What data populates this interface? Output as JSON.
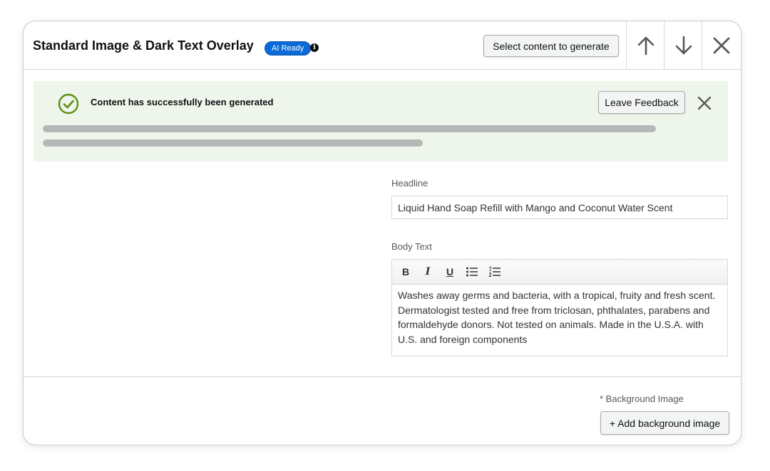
{
  "header": {
    "title": "Standard Image & Dark Text Overlay",
    "badge": "AI Ready",
    "info_glyph": "i",
    "select_button": "Select content to generate",
    "icons": [
      "arrow-up-icon",
      "arrow-down-icon",
      "close-icon"
    ]
  },
  "banner": {
    "message": "Content has successfully been generated",
    "feedback_button": "Leave Feedback",
    "icons": [
      "check-circle-icon",
      "close-icon"
    ],
    "accent_color": "#5a8d10",
    "background_color": "#eef6ec"
  },
  "form": {
    "headline_label": "Headline",
    "headline_value": "Liquid Hand Soap Refill with Mango and Coconut Water Scent",
    "body_label": "Body Text",
    "toolbar": {
      "bold": "B",
      "italic": "I",
      "underline": "U",
      "icons": [
        "bold-icon",
        "italic-icon",
        "underline-icon",
        "bullet-list-icon",
        "numbered-list-icon"
      ]
    },
    "body_value": "Washes away germs and bacteria, with a tropical, fruity and fresh scent. Dermatologist tested and free from triclosan, phthalates, parabens and formaldehyde donors. Not tested on animals. Made in the U.S.A. with U.S. and foreign components"
  },
  "footer": {
    "background_label": "* Background Image",
    "add_button": "+ Add background image"
  },
  "colors": {
    "badge": "#0a6bd8",
    "border": "#d5d9d9",
    "skeleton": "#b4b9b8"
  }
}
